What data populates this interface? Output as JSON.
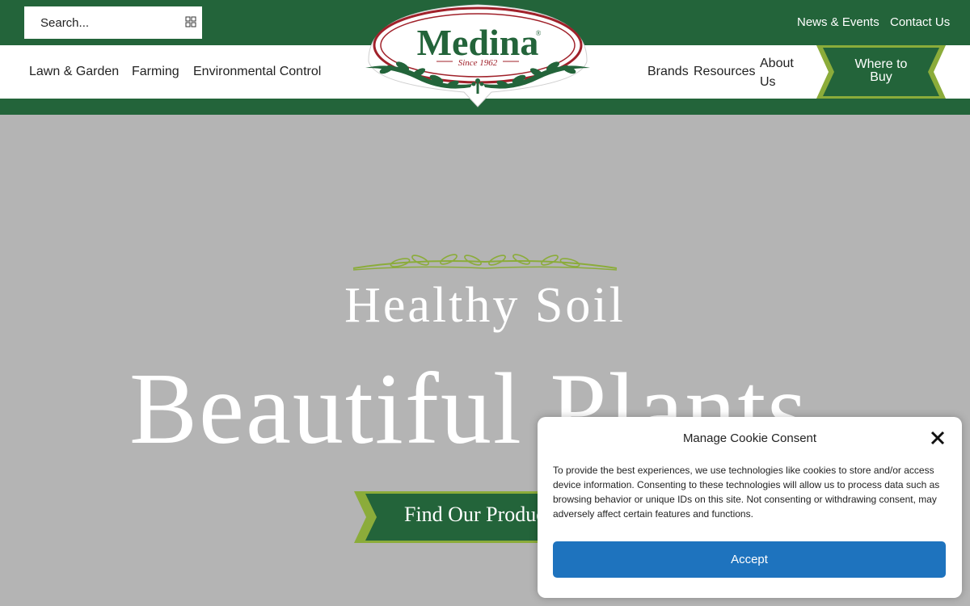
{
  "header": {
    "search": {
      "placeholder": "Search..."
    },
    "top_links": [
      "News & Events",
      "Contact Us"
    ],
    "logo": {
      "name": "Medina",
      "registered": "®",
      "tagline": "Since 1962"
    },
    "nav_left": [
      "Lawn & Garden",
      "Farming",
      "Environmental Control"
    ],
    "nav_right": [
      "Brands",
      "Resources"
    ],
    "nav_about": [
      "About",
      "Us"
    ],
    "cta": {
      "line1": "Where to",
      "line2": "Buy"
    }
  },
  "hero": {
    "subtitle": "Healthy Soil",
    "title": "Beautiful Plants",
    "button_label": "Find Our Products"
  },
  "cookie_banner": {
    "title": "Manage Cookie Consent",
    "text": "To provide the best experiences, we use technologies like cookies to store and/or access device information. Consenting to these technologies will allow us to process data such as browsing behavior or unique IDs on this site. Not consenting or withdrawing consent, may adversely affect certain features and functions.",
    "accept_label": "Accept"
  },
  "colors": {
    "brand_green": "#23643a",
    "accent_green": "#8bac3a",
    "logo_red": "#a0212a",
    "hero_bg": "#b4b4b4",
    "accept_blue": "#1e73be"
  },
  "icons": {
    "search": "search-icon",
    "close": "close-icon"
  }
}
